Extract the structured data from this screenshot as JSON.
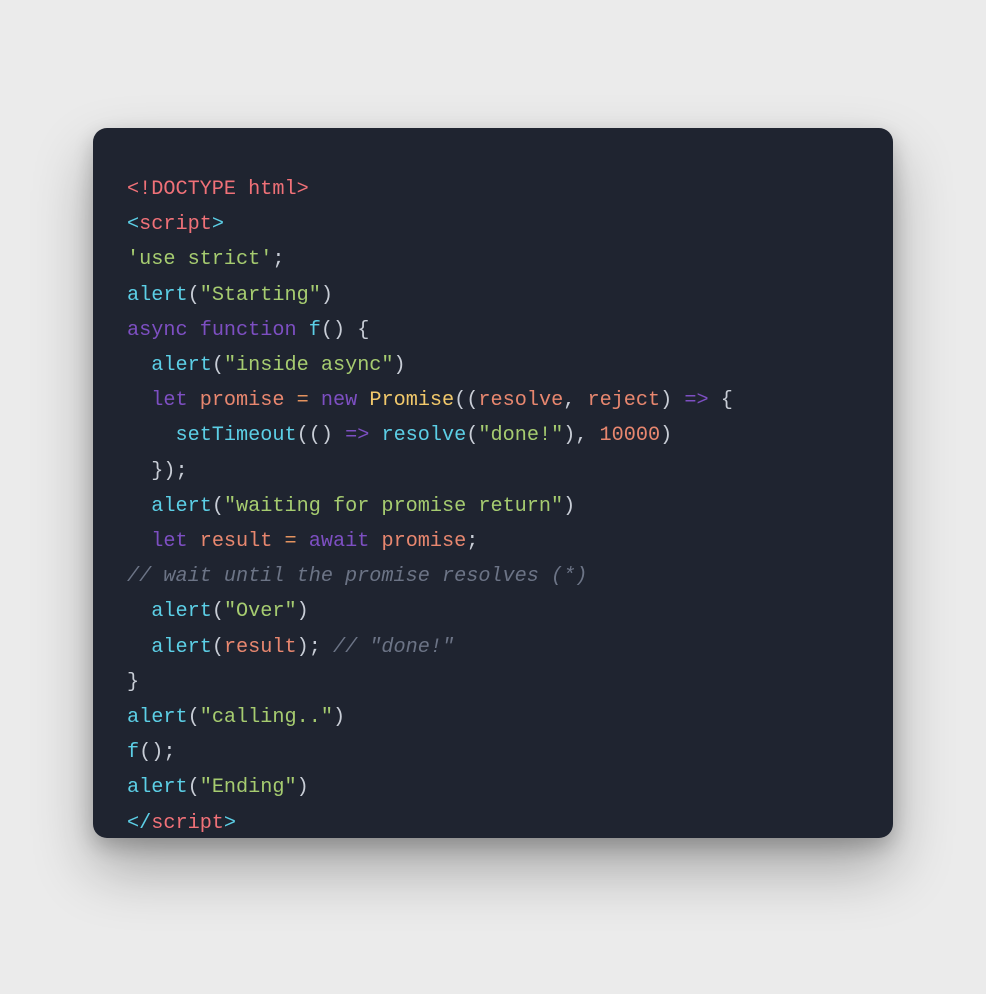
{
  "colors": {
    "page_bg": "#ebebeb",
    "card_bg": "#1f2430",
    "text_default": "#c8cdd6",
    "doctype": "#f07178",
    "tag_angle": "#5ccfe6",
    "tag_name": "#f07178",
    "string": "#a6cc70",
    "function_call": "#5ccfe6",
    "keyword": "#7d4fc2",
    "identifier": "#e8876f",
    "class_name": "#f2c96b",
    "number": "#e8876f",
    "operator": "#e4935f",
    "comment": "#6c7486"
  },
  "code": {
    "lines": [
      [
        {
          "cls": "tok-doctype",
          "t": "<!DOCTYPE html>"
        }
      ],
      [
        {
          "cls": "tok-tag-angle",
          "t": "<"
        },
        {
          "cls": "tok-tag-name",
          "t": "script"
        },
        {
          "cls": "tok-tag-angle",
          "t": ">"
        }
      ],
      [
        {
          "cls": "tok-string",
          "t": "'use strict'"
        },
        {
          "cls": "tok-punct",
          "t": ";"
        }
      ],
      [
        {
          "cls": "tok-fn",
          "t": "alert"
        },
        {
          "cls": "tok-punct",
          "t": "("
        },
        {
          "cls": "tok-string",
          "t": "\"Starting\""
        },
        {
          "cls": "tok-punct",
          "t": ")"
        }
      ],
      [
        {
          "cls": "tok-kw-async",
          "t": "async"
        },
        {
          "cls": "tok-punct",
          "t": " "
        },
        {
          "cls": "tok-kw-func",
          "t": "function"
        },
        {
          "cls": "tok-punct",
          "t": " "
        },
        {
          "cls": "tok-fn",
          "t": "f"
        },
        {
          "cls": "tok-punct",
          "t": "() {"
        }
      ],
      [
        {
          "cls": "tok-punct",
          "t": "  "
        },
        {
          "cls": "tok-fn",
          "t": "alert"
        },
        {
          "cls": "tok-punct",
          "t": "("
        },
        {
          "cls": "tok-string",
          "t": "\"inside async\""
        },
        {
          "cls": "tok-punct",
          "t": ")"
        }
      ],
      [
        {
          "cls": "tok-punct",
          "t": "  "
        },
        {
          "cls": "tok-kw-let",
          "t": "let"
        },
        {
          "cls": "tok-punct",
          "t": " "
        },
        {
          "cls": "tok-ident",
          "t": "promise"
        },
        {
          "cls": "tok-punct",
          "t": " "
        },
        {
          "cls": "tok-op",
          "t": "="
        },
        {
          "cls": "tok-punct",
          "t": " "
        },
        {
          "cls": "tok-kw-new",
          "t": "new"
        },
        {
          "cls": "tok-punct",
          "t": " "
        },
        {
          "cls": "tok-class",
          "t": "Promise"
        },
        {
          "cls": "tok-punct",
          "t": "(("
        },
        {
          "cls": "tok-param",
          "t": "resolve"
        },
        {
          "cls": "tok-punct",
          "t": ", "
        },
        {
          "cls": "tok-param",
          "t": "reject"
        },
        {
          "cls": "tok-punct",
          "t": ") "
        },
        {
          "cls": "tok-arrow",
          "t": "=>"
        },
        {
          "cls": "tok-punct",
          "t": " {"
        }
      ],
      [
        {
          "cls": "tok-punct",
          "t": "    "
        },
        {
          "cls": "tok-fn",
          "t": "setTimeout"
        },
        {
          "cls": "tok-punct",
          "t": "(() "
        },
        {
          "cls": "tok-arrow",
          "t": "=>"
        },
        {
          "cls": "tok-punct",
          "t": " "
        },
        {
          "cls": "tok-fn",
          "t": "resolve"
        },
        {
          "cls": "tok-punct",
          "t": "("
        },
        {
          "cls": "tok-string",
          "t": "\"done!\""
        },
        {
          "cls": "tok-punct",
          "t": "), "
        },
        {
          "cls": "tok-num",
          "t": "10000"
        },
        {
          "cls": "tok-punct",
          "t": ")"
        }
      ],
      [
        {
          "cls": "tok-punct",
          "t": "  });"
        }
      ],
      [
        {
          "cls": "tok-punct",
          "t": "  "
        },
        {
          "cls": "tok-fn",
          "t": "alert"
        },
        {
          "cls": "tok-punct",
          "t": "("
        },
        {
          "cls": "tok-string",
          "t": "\"waiting for promise return\""
        },
        {
          "cls": "tok-punct",
          "t": ")"
        }
      ],
      [
        {
          "cls": "tok-punct",
          "t": "  "
        },
        {
          "cls": "tok-kw-let",
          "t": "let"
        },
        {
          "cls": "tok-punct",
          "t": " "
        },
        {
          "cls": "tok-ident",
          "t": "result"
        },
        {
          "cls": "tok-punct",
          "t": " "
        },
        {
          "cls": "tok-op",
          "t": "="
        },
        {
          "cls": "tok-punct",
          "t": " "
        },
        {
          "cls": "tok-kw-await",
          "t": "await"
        },
        {
          "cls": "tok-punct",
          "t": " "
        },
        {
          "cls": "tok-ident",
          "t": "promise"
        },
        {
          "cls": "tok-punct",
          "t": ";"
        }
      ],
      [
        {
          "cls": "tok-comment",
          "t": "// wait until the promise resolves (*)"
        }
      ],
      [
        {
          "cls": "tok-punct",
          "t": "  "
        },
        {
          "cls": "tok-fn",
          "t": "alert"
        },
        {
          "cls": "tok-punct",
          "t": "("
        },
        {
          "cls": "tok-string",
          "t": "\"Over\""
        },
        {
          "cls": "tok-punct",
          "t": ")"
        }
      ],
      [
        {
          "cls": "tok-punct",
          "t": "  "
        },
        {
          "cls": "tok-fn",
          "t": "alert"
        },
        {
          "cls": "tok-punct",
          "t": "("
        },
        {
          "cls": "tok-ident",
          "t": "result"
        },
        {
          "cls": "tok-punct",
          "t": "); "
        },
        {
          "cls": "tok-comment",
          "t": "// \"done!\""
        }
      ],
      [
        {
          "cls": "tok-punct",
          "t": "}"
        }
      ],
      [
        {
          "cls": "tok-fn",
          "t": "alert"
        },
        {
          "cls": "tok-punct",
          "t": "("
        },
        {
          "cls": "tok-string",
          "t": "\"calling..\""
        },
        {
          "cls": "tok-punct",
          "t": ")"
        }
      ],
      [
        {
          "cls": "tok-fn",
          "t": "f"
        },
        {
          "cls": "tok-punct",
          "t": "();"
        }
      ],
      [
        {
          "cls": "tok-fn",
          "t": "alert"
        },
        {
          "cls": "tok-punct",
          "t": "("
        },
        {
          "cls": "tok-string",
          "t": "\"Ending\""
        },
        {
          "cls": "tok-punct",
          "t": ")"
        }
      ],
      [
        {
          "cls": "tok-tag-angle",
          "t": "</"
        },
        {
          "cls": "tok-tag-name",
          "t": "script"
        },
        {
          "cls": "tok-tag-angle",
          "t": ">"
        }
      ]
    ]
  }
}
